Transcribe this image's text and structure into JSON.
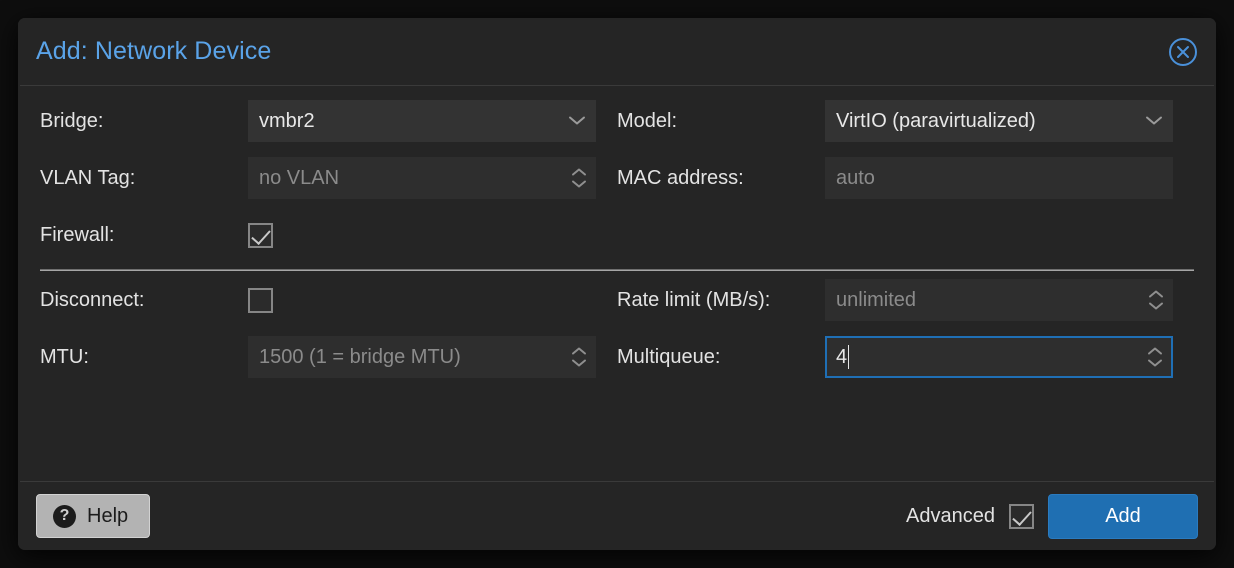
{
  "dialog": {
    "title": "Add: Network Device",
    "close_icon": "close-circle-icon"
  },
  "form": {
    "basic": {
      "left": [
        {
          "label": "Bridge:",
          "value": "vmbr2",
          "placeholder": "",
          "control": "combobox",
          "state": "enabled",
          "name": "bridge"
        },
        {
          "label": "VLAN Tag:",
          "value": "",
          "placeholder": "no VLAN",
          "control": "spinner",
          "state": "disabled",
          "name": "vlan-tag"
        },
        {
          "label": "Firewall:",
          "value": "checked",
          "control": "checkbox",
          "state": "enabled",
          "name": "firewall"
        }
      ],
      "right": [
        {
          "label": "Model:",
          "value": "VirtIO (paravirtualized)",
          "placeholder": "",
          "control": "combobox",
          "state": "enabled",
          "name": "model"
        },
        {
          "label": "MAC address:",
          "value": "",
          "placeholder": "auto",
          "control": "textfield",
          "state": "disabled",
          "name": "mac-address"
        }
      ]
    },
    "advanced": {
      "left": [
        {
          "label": "Disconnect:",
          "value": "unchecked",
          "control": "checkbox",
          "state": "enabled",
          "name": "disconnect"
        },
        {
          "label": "MTU:",
          "value": "",
          "placeholder": "1500 (1 = bridge MTU)",
          "control": "spinner",
          "state": "disabled",
          "name": "mtu"
        }
      ],
      "right": [
        {
          "label": "Rate limit (MB/s):",
          "value": "",
          "placeholder": "unlimited",
          "control": "spinner",
          "state": "disabled",
          "name": "rate-limit"
        },
        {
          "label": "Multiqueue:",
          "value": "4",
          "placeholder": "",
          "control": "spinner",
          "state": "focused",
          "name": "multiqueue"
        }
      ]
    }
  },
  "footer": {
    "help_label": "Help",
    "help_icon": "question-mark-icon",
    "advanced_label": "Advanced",
    "advanced_checked": "checked",
    "add_label": "Add"
  },
  "colors": {
    "accent_blue": "#1f6fb2",
    "title_blue": "#5aa3e8",
    "dialog_bg": "#252525",
    "field_bg": "#333333",
    "field_disabled_bg": "#2e2e2e",
    "placeholder_text": "#8b8b8b",
    "label_text": "#e3e3e3",
    "help_button_bg": "#b3b3b3"
  }
}
